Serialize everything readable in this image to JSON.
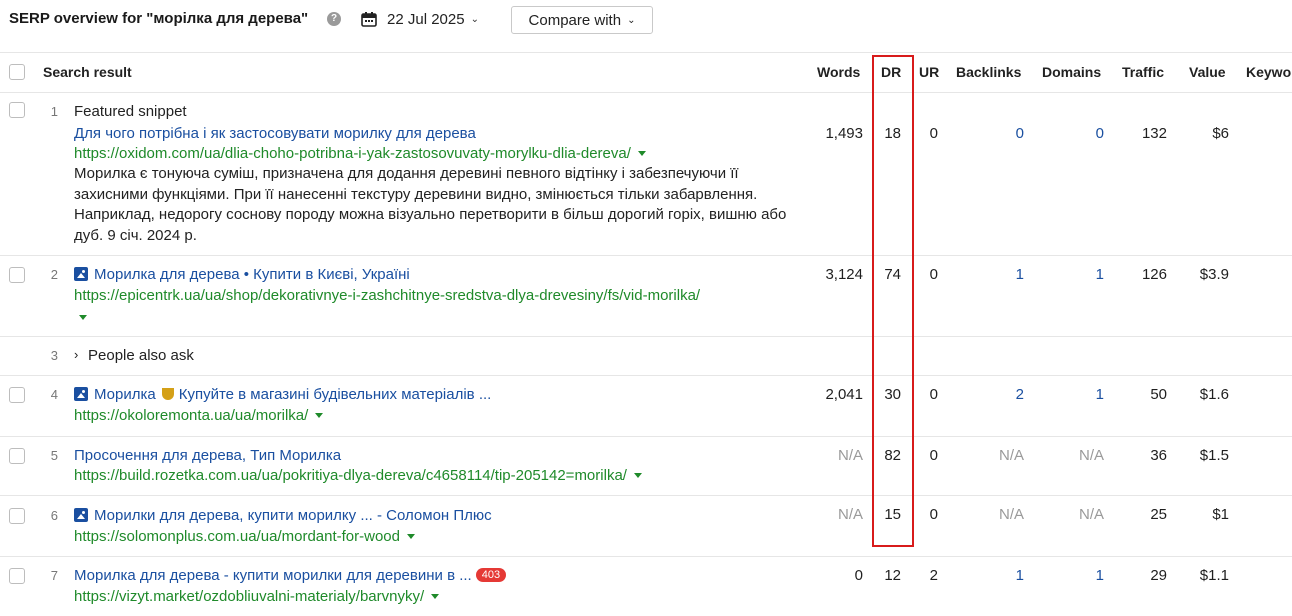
{
  "header": {
    "title": "SERP overview for \"морілка для дерева\"",
    "help": "?",
    "date": "22 Jul 2025",
    "compare_label": "Compare with"
  },
  "columns": {
    "result": "Search result",
    "words": "Words",
    "dr": "DR",
    "ur": "UR",
    "backlinks": "Backlinks",
    "domains": "Domains",
    "traffic": "Traffic",
    "value": "Value",
    "keywords": "Keywo"
  },
  "rows": [
    {
      "num": "1",
      "label": "Featured snippet",
      "title": "Для чого потрібна і як застосовувати морилку для дерева",
      "url": "https://oxidom.com/ua/dlia-choho-potribna-i-yak-zastosovuvaty-morylku-dlia-dereva/",
      "snippet": "Морилка є тонуюча суміш, призначена для додання деревині певного відтінку і забезпечуючи її захисними функціями. При її нанесенні текстуру деревини видно, змінюється тільки забарвлення. Наприклад, недорогу соснову породу можна візуально перетворити в більш дорогий горіх, вишню або дуб. 9 січ. 2024 р.",
      "words": "1,493",
      "dr": "18",
      "ur": "0",
      "backlinks": "0",
      "domains": "0",
      "traffic": "132",
      "value": "$6"
    },
    {
      "num": "2",
      "title": "Морилка для дерева • Купити в Києві, Україні",
      "url": "https://epicentrk.ua/ua/shop/dekorativnye-i-zashchitnye-sredstva-dlya-drevesiny/fs/vid-morilka/",
      "words": "3,124",
      "dr": "74",
      "ur": "0",
      "backlinks": "1",
      "domains": "1",
      "traffic": "126",
      "value": "$3.9"
    },
    {
      "num": "3",
      "label": "People also ask"
    },
    {
      "num": "4",
      "title_a": "Морилка",
      "title_b": "Купуйте в магазині будівельних матеріалів ...",
      "url": "https://okoloremonta.ua/ua/morilka/",
      "words": "2,041",
      "dr": "30",
      "ur": "0",
      "backlinks": "2",
      "domains": "1",
      "traffic": "50",
      "value": "$1.6"
    },
    {
      "num": "5",
      "title": "Просочення для дерева, Тип Морилка",
      "url": "https://build.rozetka.com.ua/ua/pokritiya-dlya-dereva/c4658114/tip-205142=morilka/",
      "words": "N/A",
      "dr": "82",
      "ur": "0",
      "backlinks": "N/A",
      "domains": "N/A",
      "traffic": "36",
      "value": "$1.5"
    },
    {
      "num": "6",
      "title": "Морилки для дерева, купити морилку ... - Соломон Плюс",
      "url": "https://solomonplus.com.ua/ua/mordant-for-wood",
      "words": "N/A",
      "dr": "15",
      "ur": "0",
      "backlinks": "N/A",
      "domains": "N/A",
      "traffic": "25",
      "value": "$1"
    },
    {
      "num": "7",
      "title": "Морилка для дерева - купити морилки для деревини в ...",
      "badge": "403",
      "url": "https://vizyt.market/ozdobliuvalni-materialy/barvnyky/",
      "words": "0",
      "dr": "12",
      "ur": "2",
      "backlinks": "1",
      "domains": "1",
      "traffic": "29",
      "value": "$1.1"
    }
  ],
  "colors": {
    "link": "#1a4fa0",
    "url": "#1f8a2a",
    "highlight": "#d81b1b",
    "badge": "#e53935"
  }
}
